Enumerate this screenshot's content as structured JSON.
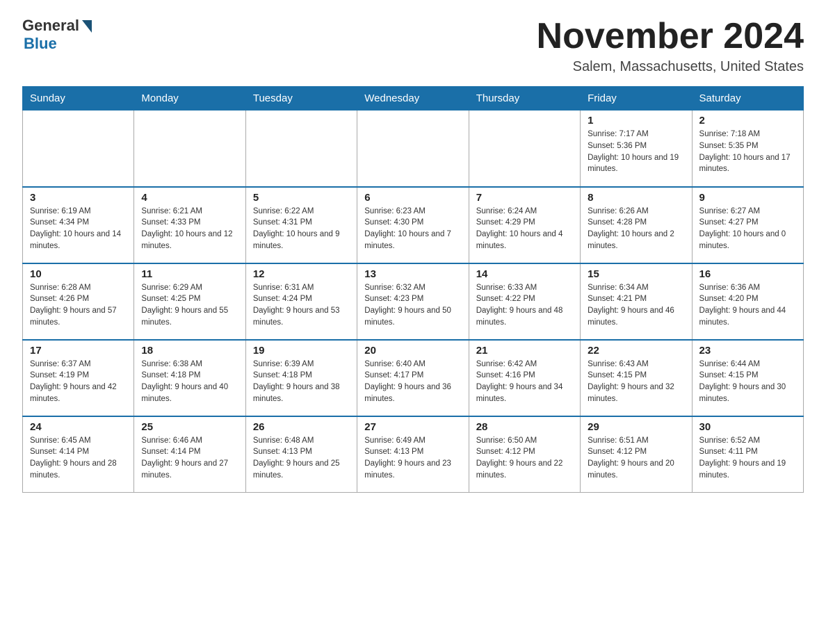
{
  "header": {
    "logo_general": "General",
    "logo_blue": "Blue",
    "month_title": "November 2024",
    "location": "Salem, Massachusetts, United States"
  },
  "weekdays": [
    "Sunday",
    "Monday",
    "Tuesday",
    "Wednesday",
    "Thursday",
    "Friday",
    "Saturday"
  ],
  "weeks": [
    [
      {
        "day": "",
        "info": ""
      },
      {
        "day": "",
        "info": ""
      },
      {
        "day": "",
        "info": ""
      },
      {
        "day": "",
        "info": ""
      },
      {
        "day": "",
        "info": ""
      },
      {
        "day": "1",
        "info": "Sunrise: 7:17 AM\nSunset: 5:36 PM\nDaylight: 10 hours and 19 minutes."
      },
      {
        "day": "2",
        "info": "Sunrise: 7:18 AM\nSunset: 5:35 PM\nDaylight: 10 hours and 17 minutes."
      }
    ],
    [
      {
        "day": "3",
        "info": "Sunrise: 6:19 AM\nSunset: 4:34 PM\nDaylight: 10 hours and 14 minutes."
      },
      {
        "day": "4",
        "info": "Sunrise: 6:21 AM\nSunset: 4:33 PM\nDaylight: 10 hours and 12 minutes."
      },
      {
        "day": "5",
        "info": "Sunrise: 6:22 AM\nSunset: 4:31 PM\nDaylight: 10 hours and 9 minutes."
      },
      {
        "day": "6",
        "info": "Sunrise: 6:23 AM\nSunset: 4:30 PM\nDaylight: 10 hours and 7 minutes."
      },
      {
        "day": "7",
        "info": "Sunrise: 6:24 AM\nSunset: 4:29 PM\nDaylight: 10 hours and 4 minutes."
      },
      {
        "day": "8",
        "info": "Sunrise: 6:26 AM\nSunset: 4:28 PM\nDaylight: 10 hours and 2 minutes."
      },
      {
        "day": "9",
        "info": "Sunrise: 6:27 AM\nSunset: 4:27 PM\nDaylight: 10 hours and 0 minutes."
      }
    ],
    [
      {
        "day": "10",
        "info": "Sunrise: 6:28 AM\nSunset: 4:26 PM\nDaylight: 9 hours and 57 minutes."
      },
      {
        "day": "11",
        "info": "Sunrise: 6:29 AM\nSunset: 4:25 PM\nDaylight: 9 hours and 55 minutes."
      },
      {
        "day": "12",
        "info": "Sunrise: 6:31 AM\nSunset: 4:24 PM\nDaylight: 9 hours and 53 minutes."
      },
      {
        "day": "13",
        "info": "Sunrise: 6:32 AM\nSunset: 4:23 PM\nDaylight: 9 hours and 50 minutes."
      },
      {
        "day": "14",
        "info": "Sunrise: 6:33 AM\nSunset: 4:22 PM\nDaylight: 9 hours and 48 minutes."
      },
      {
        "day": "15",
        "info": "Sunrise: 6:34 AM\nSunset: 4:21 PM\nDaylight: 9 hours and 46 minutes."
      },
      {
        "day": "16",
        "info": "Sunrise: 6:36 AM\nSunset: 4:20 PM\nDaylight: 9 hours and 44 minutes."
      }
    ],
    [
      {
        "day": "17",
        "info": "Sunrise: 6:37 AM\nSunset: 4:19 PM\nDaylight: 9 hours and 42 minutes."
      },
      {
        "day": "18",
        "info": "Sunrise: 6:38 AM\nSunset: 4:18 PM\nDaylight: 9 hours and 40 minutes."
      },
      {
        "day": "19",
        "info": "Sunrise: 6:39 AM\nSunset: 4:18 PM\nDaylight: 9 hours and 38 minutes."
      },
      {
        "day": "20",
        "info": "Sunrise: 6:40 AM\nSunset: 4:17 PM\nDaylight: 9 hours and 36 minutes."
      },
      {
        "day": "21",
        "info": "Sunrise: 6:42 AM\nSunset: 4:16 PM\nDaylight: 9 hours and 34 minutes."
      },
      {
        "day": "22",
        "info": "Sunrise: 6:43 AM\nSunset: 4:15 PM\nDaylight: 9 hours and 32 minutes."
      },
      {
        "day": "23",
        "info": "Sunrise: 6:44 AM\nSunset: 4:15 PM\nDaylight: 9 hours and 30 minutes."
      }
    ],
    [
      {
        "day": "24",
        "info": "Sunrise: 6:45 AM\nSunset: 4:14 PM\nDaylight: 9 hours and 28 minutes."
      },
      {
        "day": "25",
        "info": "Sunrise: 6:46 AM\nSunset: 4:14 PM\nDaylight: 9 hours and 27 minutes."
      },
      {
        "day": "26",
        "info": "Sunrise: 6:48 AM\nSunset: 4:13 PM\nDaylight: 9 hours and 25 minutes."
      },
      {
        "day": "27",
        "info": "Sunrise: 6:49 AM\nSunset: 4:13 PM\nDaylight: 9 hours and 23 minutes."
      },
      {
        "day": "28",
        "info": "Sunrise: 6:50 AM\nSunset: 4:12 PM\nDaylight: 9 hours and 22 minutes."
      },
      {
        "day": "29",
        "info": "Sunrise: 6:51 AM\nSunset: 4:12 PM\nDaylight: 9 hours and 20 minutes."
      },
      {
        "day": "30",
        "info": "Sunrise: 6:52 AM\nSunset: 4:11 PM\nDaylight: 9 hours and 19 minutes."
      }
    ]
  ]
}
